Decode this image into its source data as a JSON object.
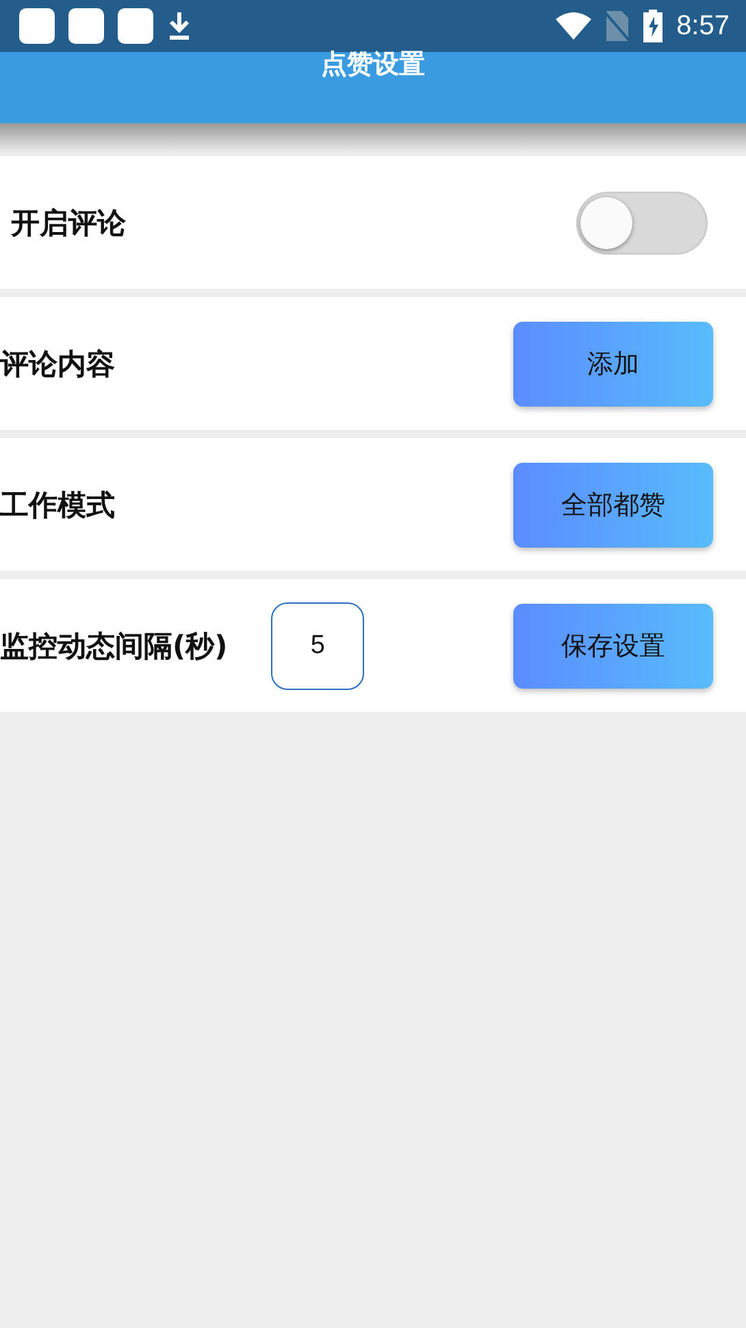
{
  "status_bar": {
    "time": "8:57"
  },
  "app_bar": {
    "title": "点赞设置"
  },
  "settings": [
    {
      "kind": "toggle",
      "label": "开启评论",
      "on": false
    },
    {
      "kind": "button",
      "label": "评论内容",
      "button": "添加"
    },
    {
      "kind": "button",
      "label": "工作模式",
      "button": "全部都赞"
    },
    {
      "kind": "input",
      "label": "监控动态间隔(秒)",
      "value": "5",
      "button": "保存设置"
    }
  ]
}
